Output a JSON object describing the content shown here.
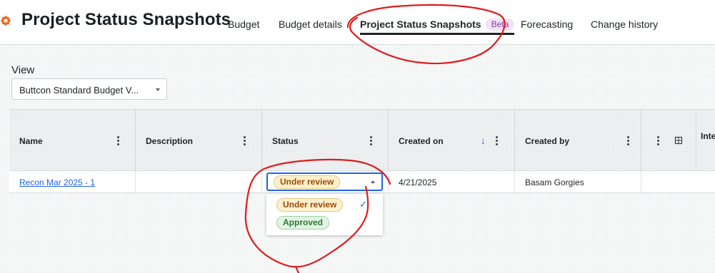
{
  "header": {
    "title": "Project Status Snapshots",
    "tabs": [
      {
        "label": "Budget"
      },
      {
        "label": "Budget details"
      },
      {
        "label": "Project Status Snapshots",
        "badge": "Beta",
        "active": true
      },
      {
        "label": "Forecasting"
      },
      {
        "label": "Change history"
      }
    ],
    "logo_icon": "gear-flower-icon",
    "logo_color": "#f26a21"
  },
  "view": {
    "label": "View",
    "selected": "Buttcon Standard Budget V..."
  },
  "table": {
    "columns": [
      {
        "label": "Name"
      },
      {
        "label": "Description"
      },
      {
        "label": "Status"
      },
      {
        "label": "Created on",
        "sorted": "descending"
      },
      {
        "label": "Created by"
      },
      {
        "label": ""
      },
      {
        "label": "Inte"
      }
    ],
    "rows": [
      {
        "name": "Recon Mar 2025 - 1",
        "description": "",
        "status": "Under review",
        "created_on": "4/21/2025",
        "created_by": "Basam Gorgies"
      }
    ]
  },
  "status_dropdown": {
    "open": true,
    "selected": "Under review",
    "options": [
      {
        "label": "Under review",
        "checked": true
      },
      {
        "label": "Approved",
        "checked": false
      }
    ]
  },
  "colors": {
    "accent": "#2066df",
    "annotation_red": "#e01b1b",
    "review_text": "#9b4a05",
    "approved_text": "#2b7a3a",
    "beta_text": "#8a3b9c"
  }
}
